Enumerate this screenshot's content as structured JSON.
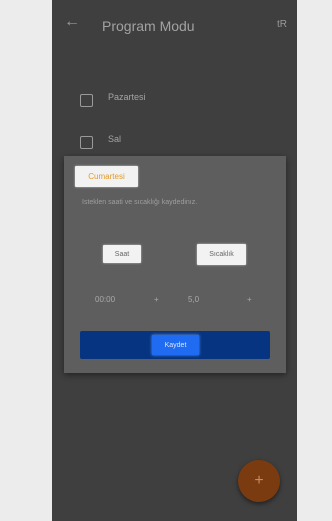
{
  "header": {
    "back_icon": "arrow-left-icon",
    "title": "Program Modu",
    "action_label": "tR"
  },
  "list": {
    "items": [
      {
        "label": "Pazartesi",
        "checked": false
      },
      {
        "label": "Sal",
        "checked": false
      }
    ]
  },
  "dialog": {
    "title": "Cumartesi",
    "description": "Isteklen saati ve sıcaklığı kaydedinız.",
    "hour_label": "Saat",
    "temp_label": "Sıcaklık",
    "time_value": "00:00",
    "time_plus": "+",
    "temp_value": "5,0",
    "temp_plus": "+",
    "save_label": "Kaydet"
  },
  "fab": {
    "icon": "plus-icon",
    "label": "+"
  },
  "colors": {
    "dialog_title": "#e39a2a",
    "save_button": "#1f6bf2",
    "save_bar": "#063480",
    "fab": "#7a3b10"
  }
}
